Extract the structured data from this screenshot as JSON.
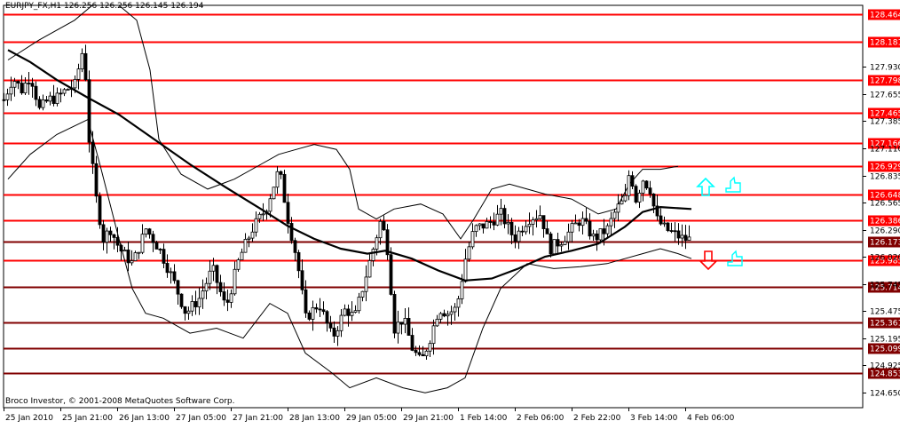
{
  "header": {
    "symbol": "EURJPY_FX,H1",
    "ohlc": "126.256 126.256 126.145 126.194"
  },
  "footer": {
    "copyright": "Broco Investor, © 2001-2008 MetaQuotes Software Corp."
  },
  "colors": {
    "background": "#ffffff",
    "grid": "#c0c0c0",
    "level_line": "#ff0000",
    "dark_level_line": "#800000",
    "candles": "#000000",
    "moving_average": "#000000",
    "bands": "#000000",
    "buy_signal": "#00ffff",
    "sell_signal": "#ff0000",
    "label_bg_red": "#ff0000",
    "label_bg_dark": "#800000"
  },
  "chart_data": {
    "type": "candlestick",
    "title": "EURJPY_FX,H1",
    "ylim": [
      124.5,
      128.55
    ],
    "y_ticks": [
      "127.930",
      "127.655",
      "127.385",
      "127.110",
      "126.835",
      "126.565",
      "126.290",
      "126.020",
      "125.745",
      "125.475",
      "125.195",
      "124.925",
      "124.650"
    ],
    "x_ticks": [
      "25 Jan 2010",
      "25 Jan 21:00",
      "26 Jan 13:00",
      "27 Jan 05:00",
      "27 Jan 21:00",
      "28 Jan 13:00",
      "29 Jan 05:00",
      "29 Jan 21:00",
      "1 Feb 14:00",
      "2 Feb 06:00",
      "2 Feb 22:00",
      "3 Feb 14:00",
      "4 Feb 06:00"
    ],
    "levels": [
      {
        "label": "128.464",
        "value": 128.464,
        "style": "red"
      },
      {
        "label": "128.181",
        "value": 128.181,
        "style": "red"
      },
      {
        "label": "127.798",
        "value": 127.798,
        "style": "red"
      },
      {
        "label": "127.465",
        "value": 127.465,
        "style": "red"
      },
      {
        "label": "127.166",
        "value": 127.166,
        "style": "red"
      },
      {
        "label": "126.929",
        "value": 126.929,
        "style": "red"
      },
      {
        "label": "126.648",
        "value": 126.648,
        "style": "red"
      },
      {
        "label": "126.386",
        "value": 126.386,
        "style": "red"
      },
      {
        "label": "126.173",
        "value": 126.173,
        "style": "dark"
      },
      {
        "label": "125.985",
        "value": 125.985,
        "style": "red"
      },
      {
        "label": "125.714",
        "value": 125.714,
        "style": "dark"
      },
      {
        "label": "125.361",
        "value": 125.361,
        "style": "dark"
      },
      {
        "label": "125.099",
        "value": 125.099,
        "style": "dark"
      },
      {
        "label": "124.853",
        "value": 124.853,
        "style": "dark"
      }
    ],
    "current_price": 126.173,
    "close_path": [
      [
        0,
        127.6
      ],
      [
        10,
        127.82
      ],
      [
        20,
        127.7
      ],
      [
        30,
        127.85
      ],
      [
        40,
        127.5
      ],
      [
        50,
        127.6
      ],
      [
        60,
        127.62
      ],
      [
        70,
        127.7
      ],
      [
        80,
        127.75
      ],
      [
        90,
        128.15
      ],
      [
        96,
        127.2
      ],
      [
        104,
        126.6
      ],
      [
        112,
        126.2
      ],
      [
        120,
        126.3
      ],
      [
        130,
        126.1
      ],
      [
        145,
        125.95
      ],
      [
        160,
        126.3
      ],
      [
        175,
        126.1
      ],
      [
        190,
        125.8
      ],
      [
        205,
        125.45
      ],
      [
        220,
        125.6
      ],
      [
        235,
        125.9
      ],
      [
        250,
        125.5
      ],
      [
        265,
        126.0
      ],
      [
        280,
        126.3
      ],
      [
        295,
        126.5
      ],
      [
        310,
        126.9
      ],
      [
        320,
        126.4
      ],
      [
        330,
        126.0
      ],
      [
        340,
        125.4
      ],
      [
        355,
        125.55
      ],
      [
        370,
        125.2
      ],
      [
        385,
        125.5
      ],
      [
        395,
        125.4
      ],
      [
        410,
        125.9
      ],
      [
        425,
        126.4
      ],
      [
        432,
        126.1
      ],
      [
        440,
        125.3
      ],
      [
        450,
        125.4
      ],
      [
        460,
        125.1
      ],
      [
        470,
        124.95
      ],
      [
        480,
        125.2
      ],
      [
        490,
        125.5
      ],
      [
        500,
        125.45
      ],
      [
        510,
        125.5
      ],
      [
        520,
        126.0
      ],
      [
        530,
        126.3
      ],
      [
        545,
        126.35
      ],
      [
        560,
        126.45
      ],
      [
        575,
        126.2
      ],
      [
        590,
        126.4
      ],
      [
        605,
        126.45
      ],
      [
        615,
        126.1
      ],
      [
        630,
        126.2
      ],
      [
        650,
        126.4
      ],
      [
        665,
        126.2
      ],
      [
        680,
        126.3
      ],
      [
        690,
        126.5
      ],
      [
        700,
        126.6
      ],
      [
        705,
        126.9
      ],
      [
        712,
        126.6
      ],
      [
        720,
        126.8
      ],
      [
        728,
        126.7
      ],
      [
        735,
        126.4
      ],
      [
        745,
        126.3
      ],
      [
        755,
        126.25
      ],
      [
        765,
        126.2
      ],
      [
        775,
        126.19
      ]
    ],
    "moving_average_path": [
      [
        5,
        128.1
      ],
      [
        30,
        127.98
      ],
      [
        60,
        127.8
      ],
      [
        95,
        127.62
      ],
      [
        130,
        127.45
      ],
      [
        170,
        127.2
      ],
      [
        210,
        126.95
      ],
      [
        250,
        126.72
      ],
      [
        290,
        126.5
      ],
      [
        320,
        126.33
      ],
      [
        350,
        126.2
      ],
      [
        380,
        126.1
      ],
      [
        410,
        126.05
      ],
      [
        430,
        126.08
      ],
      [
        460,
        126.0
      ],
      [
        490,
        125.88
      ],
      [
        520,
        125.78
      ],
      [
        550,
        125.8
      ],
      [
        580,
        125.9
      ],
      [
        610,
        126.02
      ],
      [
        640,
        126.08
      ],
      [
        670,
        126.15
      ],
      [
        700,
        126.32
      ],
      [
        720,
        126.47
      ],
      [
        740,
        126.52
      ],
      [
        775,
        126.5
      ]
    ],
    "upper_band_path": [
      [
        5,
        128.0
      ],
      [
        40,
        128.2
      ],
      [
        80,
        128.4
      ],
      [
        100,
        128.55
      ],
      [
        130,
        128.55
      ],
      [
        150,
        128.4
      ],
      [
        165,
        127.9
      ],
      [
        175,
        127.2
      ],
      [
        200,
        126.85
      ],
      [
        230,
        126.7
      ],
      [
        260,
        126.8
      ],
      [
        290,
        126.95
      ],
      [
        310,
        127.05
      ],
      [
        330,
        127.1
      ],
      [
        350,
        127.15
      ],
      [
        375,
        127.1
      ],
      [
        390,
        126.9
      ],
      [
        400,
        126.5
      ],
      [
        420,
        126.4
      ],
      [
        440,
        126.5
      ],
      [
        470,
        126.55
      ],
      [
        495,
        126.45
      ],
      [
        515,
        126.2
      ],
      [
        530,
        126.4
      ],
      [
        550,
        126.7
      ],
      [
        570,
        126.75
      ],
      [
        590,
        126.7
      ],
      [
        610,
        126.65
      ],
      [
        640,
        126.6
      ],
      [
        670,
        126.45
      ],
      [
        690,
        126.5
      ],
      [
        705,
        126.75
      ],
      [
        720,
        126.9
      ],
      [
        740,
        126.9
      ],
      [
        760,
        126.93
      ]
    ],
    "lower_band_path": [
      [
        5,
        126.8
      ],
      [
        30,
        127.05
      ],
      [
        60,
        127.25
      ],
      [
        95,
        127.4
      ],
      [
        110,
        126.9
      ],
      [
        130,
        126.2
      ],
      [
        145,
        125.7
      ],
      [
        160,
        125.45
      ],
      [
        180,
        125.4
      ],
      [
        210,
        125.25
      ],
      [
        240,
        125.3
      ],
      [
        270,
        125.2
      ],
      [
        300,
        125.55
      ],
      [
        320,
        125.45
      ],
      [
        340,
        125.05
      ],
      [
        370,
        124.85
      ],
      [
        390,
        124.7
      ],
      [
        420,
        124.8
      ],
      [
        450,
        124.7
      ],
      [
        475,
        124.65
      ],
      [
        500,
        124.7
      ],
      [
        520,
        124.8
      ],
      [
        540,
        125.3
      ],
      [
        560,
        125.7
      ],
      [
        590,
        125.95
      ],
      [
        620,
        125.9
      ],
      [
        650,
        125.92
      ],
      [
        680,
        125.95
      ],
      [
        700,
        126.0
      ],
      [
        720,
        126.05
      ],
      [
        740,
        126.1
      ],
      [
        760,
        126.05
      ],
      [
        775,
        126.0
      ]
    ],
    "signals": [
      {
        "type": "buy-arrow",
        "position": "right"
      },
      {
        "type": "buy-hand",
        "position": "right"
      },
      {
        "type": "sell-arrow",
        "position": "right"
      },
      {
        "type": "sell-hand",
        "position": "right"
      }
    ]
  }
}
